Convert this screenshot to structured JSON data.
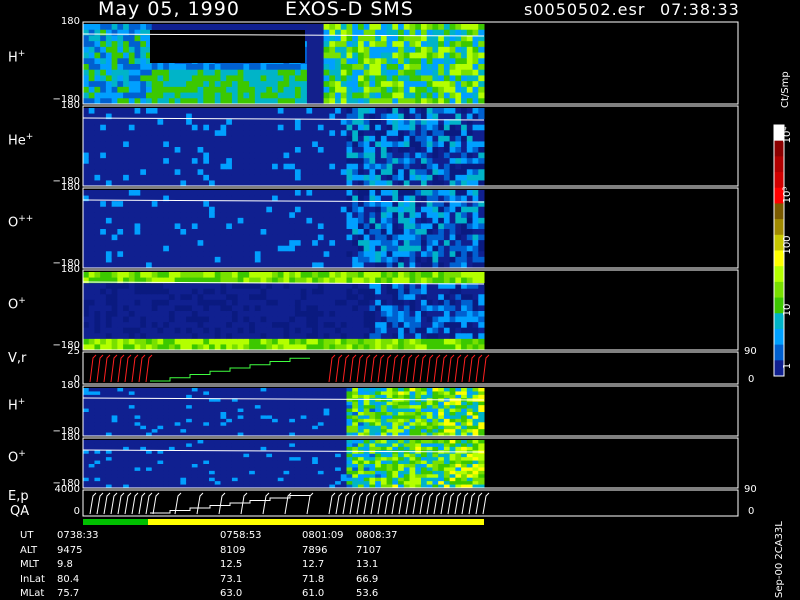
{
  "header": {
    "date": "May 05, 1990",
    "instrument": "EXOS-D SMS",
    "file": "s0050502.esr",
    "time": "07:38:33"
  },
  "panels": [
    {
      "key": "h_plus",
      "label": "H",
      "sup": "+",
      "ytop": "180",
      "ybot": "−180"
    },
    {
      "key": "he_plus",
      "label": "He",
      "sup": "+",
      "ytop": "180",
      "ybot": "−180"
    },
    {
      "key": "o_plusplus",
      "label": "O",
      "sup": "++",
      "ytop": "180",
      "ybot": "−180"
    },
    {
      "key": "o_plus",
      "label": "O",
      "sup": "+",
      "ytop": "180",
      "ybot": "−180"
    },
    {
      "key": "vr",
      "label": "V,r",
      "sup": "",
      "ytop": "25",
      "ybot": "0",
      "rtop": "90",
      "rbot": "0"
    },
    {
      "key": "h_plus_2",
      "label": "H",
      "sup": "+",
      "ytop": "180",
      "ybot": "−180"
    },
    {
      "key": "o_plus_2",
      "label": "O",
      "sup": "+",
      "ytop": "180",
      "ybot": "−180"
    },
    {
      "key": "ep",
      "label": "E,p",
      "sup": "",
      "ytop": "4000",
      "ybot": "0",
      "rtop": "90",
      "rbot": "0"
    }
  ],
  "qa_label": "QA",
  "colorbar": {
    "unit": "Ct/Smp",
    "labels": [
      "10⁴",
      "10³",
      "100",
      "10",
      "1"
    ],
    "colors": [
      "#ffffff",
      "#8b0000",
      "#b00000",
      "#d00000",
      "#ff0000",
      "#7a5a00",
      "#a08a00",
      "#c8c800",
      "#ffff00",
      "#b4ff00",
      "#78e000",
      "#3cc800",
      "#00b4c8",
      "#00a0ff",
      "#0060d0",
      "#102090"
    ]
  },
  "ephemeris": {
    "rows": [
      {
        "name": "UT",
        "values": [
          "0738:33",
          "0758:53",
          "0801:09",
          "0808:37"
        ]
      },
      {
        "name": "ALT",
        "values": [
          "9475",
          "8109",
          "7896",
          "7107"
        ]
      },
      {
        "name": "MLT",
        "values": [
          "9.8",
          "12.5",
          "12.7",
          "13.1"
        ]
      },
      {
        "name": "InLat",
        "values": [
          "80.4",
          "73.1",
          "71.8",
          "66.9"
        ]
      },
      {
        "name": "MLat",
        "values": [
          "75.7",
          "63.0",
          "61.0",
          "53.6"
        ]
      }
    ]
  },
  "footer_note": "Sep-00 2CA33L",
  "chart_data": {
    "type": "heatmap",
    "ut_ticks": [
      "0738:33",
      "0758:53",
      "0801:09",
      "0808:37"
    ],
    "panels": [
      "H+",
      "He+",
      "O++",
      "O+",
      "V,r",
      "H+",
      "O+",
      "E,p"
    ],
    "y_range_pitch": [
      -180,
      180
    ],
    "y_range_vr": [
      0,
      25
    ],
    "y_range_ep": [
      0,
      4000
    ],
    "right_range": [
      0,
      90
    ],
    "colorbar_range_ct_per_smp": [
      1,
      10000
    ],
    "colorbar_scale": "log"
  }
}
